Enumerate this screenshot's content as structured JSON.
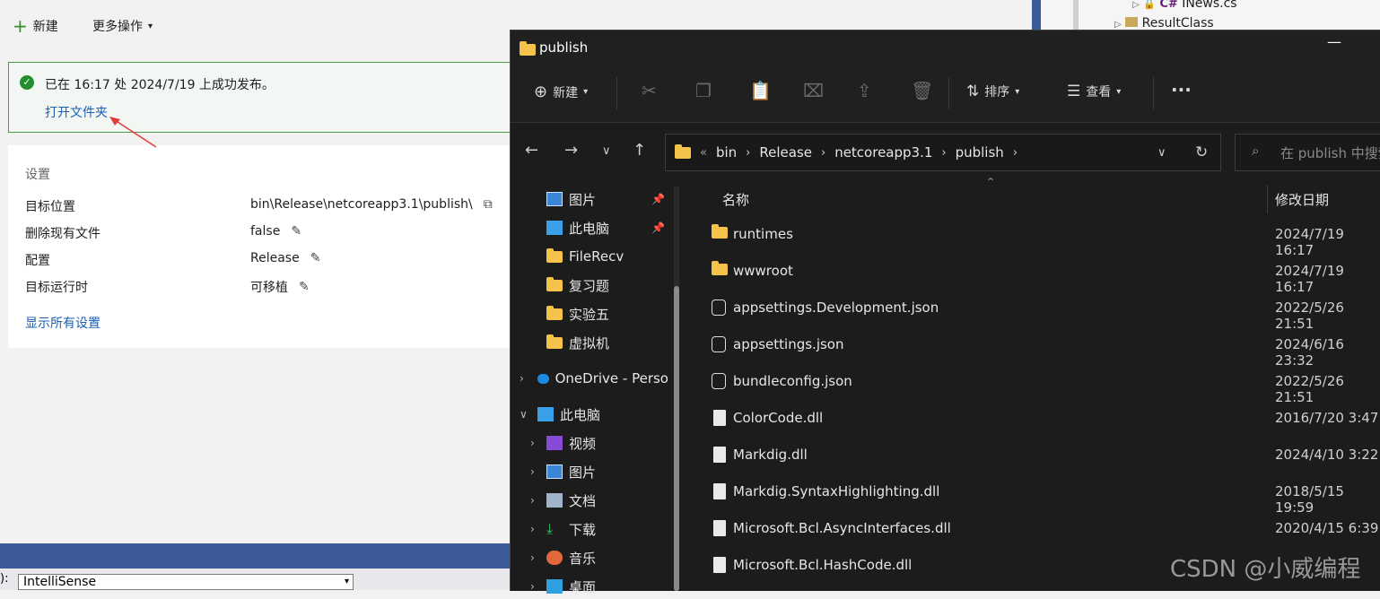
{
  "vs": {
    "toolbar": {
      "new_label": "新建",
      "more_label": "更多操作"
    },
    "success": {
      "message": "已在 16:17 处 2024/7/19 上成功发布。",
      "open_folder": "打开文件夹"
    },
    "settings": {
      "title": "设置",
      "rows": [
        {
          "label": "目标位置",
          "value": "bin\\Release\\netcoreapp3.1\\publish\\"
        },
        {
          "label": "删除现有文件",
          "value": "false"
        },
        {
          "label": "配置",
          "value": "Release"
        },
        {
          "label": "目标运行时",
          "value": "可移植"
        }
      ],
      "show_all": "显示所有设置"
    },
    "solution": {
      "item1": "INews.cs",
      "item2": "ResultClass"
    },
    "bottom": {
      "intellisense": "IntelliSense"
    }
  },
  "explorer": {
    "title": "publish",
    "toolbar": {
      "new_label": "新建",
      "sort_label": "排序",
      "view_label": "查看"
    },
    "address": {
      "crumbs": [
        "bin",
        "Release",
        "netcoreapp3.1",
        "publish"
      ]
    },
    "search_placeholder": "在 publish 中搜索",
    "nav": [
      {
        "label": "图片",
        "icon": "pictures-icon",
        "pinned": true
      },
      {
        "label": "此电脑",
        "icon": "computer-icon",
        "pinned": true
      },
      {
        "label": "FileRecv",
        "icon": "folder-icon"
      },
      {
        "label": "复习题",
        "icon": "folder-icon"
      },
      {
        "label": "实验五",
        "icon": "folder-icon"
      },
      {
        "label": "虚拟机",
        "icon": "folder-icon"
      },
      {
        "label": "OneDrive - Perso",
        "icon": "cloud-icon"
      },
      {
        "label": "此电脑",
        "icon": "computer-icon"
      },
      {
        "label": "视频",
        "icon": "video-icon"
      },
      {
        "label": "图片",
        "icon": "pictures-icon"
      },
      {
        "label": "文档",
        "icon": "documents-icon"
      },
      {
        "label": "下载",
        "icon": "download-icon"
      },
      {
        "label": "音乐",
        "icon": "music-icon"
      },
      {
        "label": "桌面",
        "icon": "desktop-icon"
      }
    ],
    "columns": {
      "name": "名称",
      "date": "修改日期"
    },
    "files": [
      {
        "name": "runtimes",
        "date": "2024/7/19 16:17",
        "icon": "folder-icon"
      },
      {
        "name": "wwwroot",
        "date": "2024/7/19 16:17",
        "icon": "folder-icon"
      },
      {
        "name": "appsettings.Development.json",
        "date": "2022/5/26 21:51",
        "icon": "json-file-icon"
      },
      {
        "name": "appsettings.json",
        "date": "2024/6/16 23:32",
        "icon": "json-file-icon"
      },
      {
        "name": "bundleconfig.json",
        "date": "2022/5/26 21:51",
        "icon": "json-file-icon"
      },
      {
        "name": "ColorCode.dll",
        "date": "2016/7/20 3:47",
        "icon": "dll-file-icon"
      },
      {
        "name": "Markdig.dll",
        "date": "2024/4/10 3:22",
        "icon": "dll-file-icon"
      },
      {
        "name": "Markdig.SyntaxHighlighting.dll",
        "date": "2018/5/15 19:59",
        "icon": "dll-file-icon"
      },
      {
        "name": "Microsoft.Bcl.AsyncInterfaces.dll",
        "date": "2020/4/15 6:39",
        "icon": "dll-file-icon"
      },
      {
        "name": "Microsoft.Bcl.HashCode.dll",
        "date": "",
        "icon": "dll-file-icon"
      }
    ]
  },
  "watermark": "CSDN @小威编程"
}
